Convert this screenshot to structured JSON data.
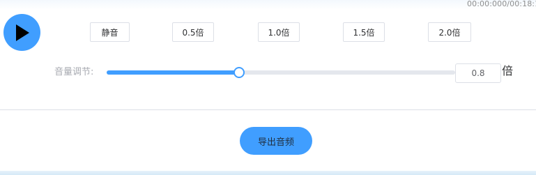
{
  "player": {
    "time_readout": "00:00:000/00:18:1",
    "play_icon": "play-icon"
  },
  "rate_buttons": {
    "mute": "静音",
    "rate_05": "0.5倍",
    "rate_10": "1.0倍",
    "rate_15": "1.5倍",
    "rate_20": "2.0倍"
  },
  "volume": {
    "label": "音量调节:",
    "value": "0.8",
    "unit": "倍",
    "slider_fraction": 0.38
  },
  "export": {
    "label": "导出音频"
  },
  "colors": {
    "accent": "#409eff",
    "track": "#e4e7ed",
    "border": "#dcdfe6"
  }
}
